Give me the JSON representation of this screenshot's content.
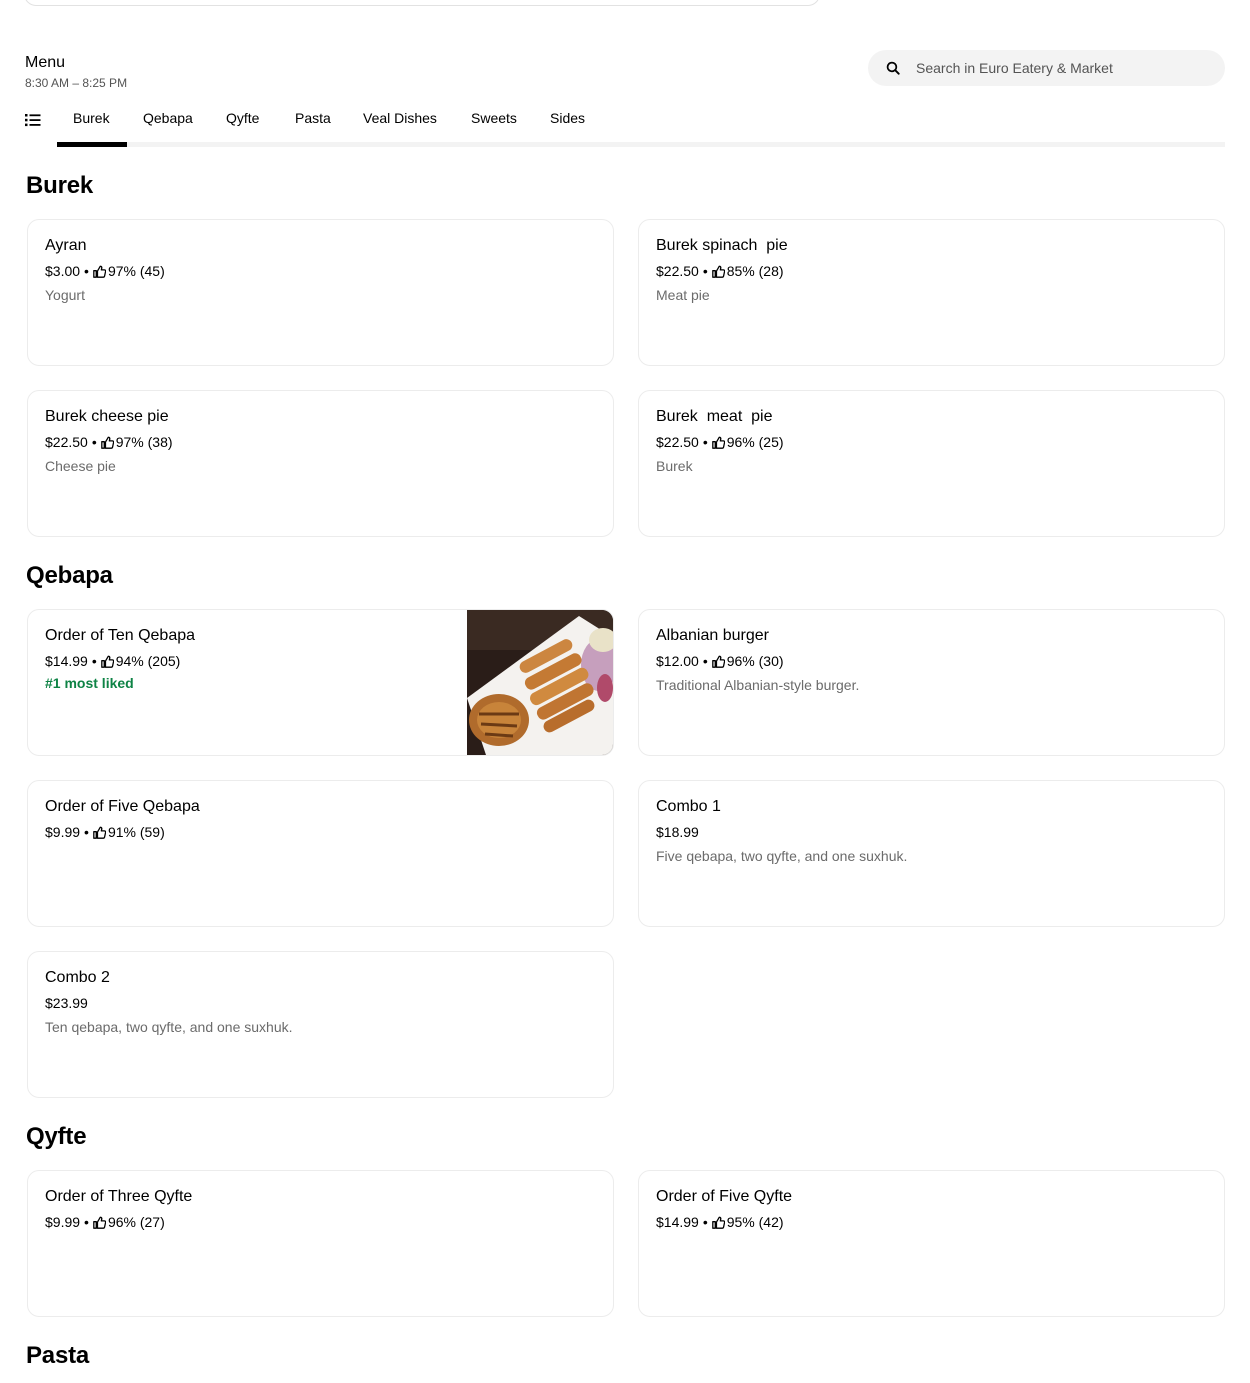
{
  "menu": {
    "title": "Menu",
    "hours": "8:30 AM – 8:25 PM"
  },
  "search": {
    "placeholder": "Search in Euro Eatery & Market"
  },
  "tabs": [
    "Burek",
    "Qebapa",
    "Qyfte",
    "Pasta",
    "Veal Dishes",
    "Sweets",
    "Sides"
  ],
  "active_tab": "Burek",
  "sections": {
    "burek": {
      "title": "Burek",
      "items": [
        {
          "name": "Ayran",
          "price": "$3.00",
          "rating": "97% (45)",
          "desc": "Yogurt"
        },
        {
          "name": "Burek spinach  pie",
          "price": "$22.50",
          "rating": "85% (28)",
          "desc": "Meat pie"
        },
        {
          "name": "Burek cheese pie",
          "price": "$22.50",
          "rating": "97% (38)",
          "desc": "Cheese pie"
        },
        {
          "name": "Burek  meat  pie",
          "price": "$22.50",
          "rating": "96% (25)",
          "desc": "Burek"
        }
      ]
    },
    "qebapa": {
      "title": "Qebapa",
      "items": [
        {
          "name": "Order of Ten Qebapa",
          "price": "$14.99",
          "rating": "94% (205)",
          "badge": "#1 most liked"
        },
        {
          "name": "Albanian burger",
          "price": "$12.00",
          "rating": "96% (30)",
          "desc": "Traditional Albanian-style burger."
        },
        {
          "name": "Order of Five Qebapa",
          "price": "$9.99",
          "rating": "91% (59)"
        },
        {
          "name": "Combo 1",
          "price": "$18.99",
          "desc": "Five qebapa, two qyfte, and one suxhuk."
        },
        {
          "name": "Combo 2",
          "price": "$23.99",
          "desc": "Ten qebapa, two qyfte, and one suxhuk."
        }
      ]
    },
    "qyfte": {
      "title": "Qyfte",
      "items": [
        {
          "name": "Order of Three Qyfte",
          "price": "$9.99",
          "rating": "96% (27)"
        },
        {
          "name": "Order of Five Qyfte",
          "price": "$14.99",
          "rating": "95% (42)"
        }
      ]
    },
    "pasta": {
      "title": "Pasta"
    }
  },
  "separator": "•",
  "icons": {
    "search": "search-icon",
    "menu_list": "list-icon",
    "rating": "thumbs-up-icon"
  },
  "colors": {
    "badge": "#0e8345",
    "description": "#6b6b6b",
    "search_bg": "#f3f3f3"
  }
}
